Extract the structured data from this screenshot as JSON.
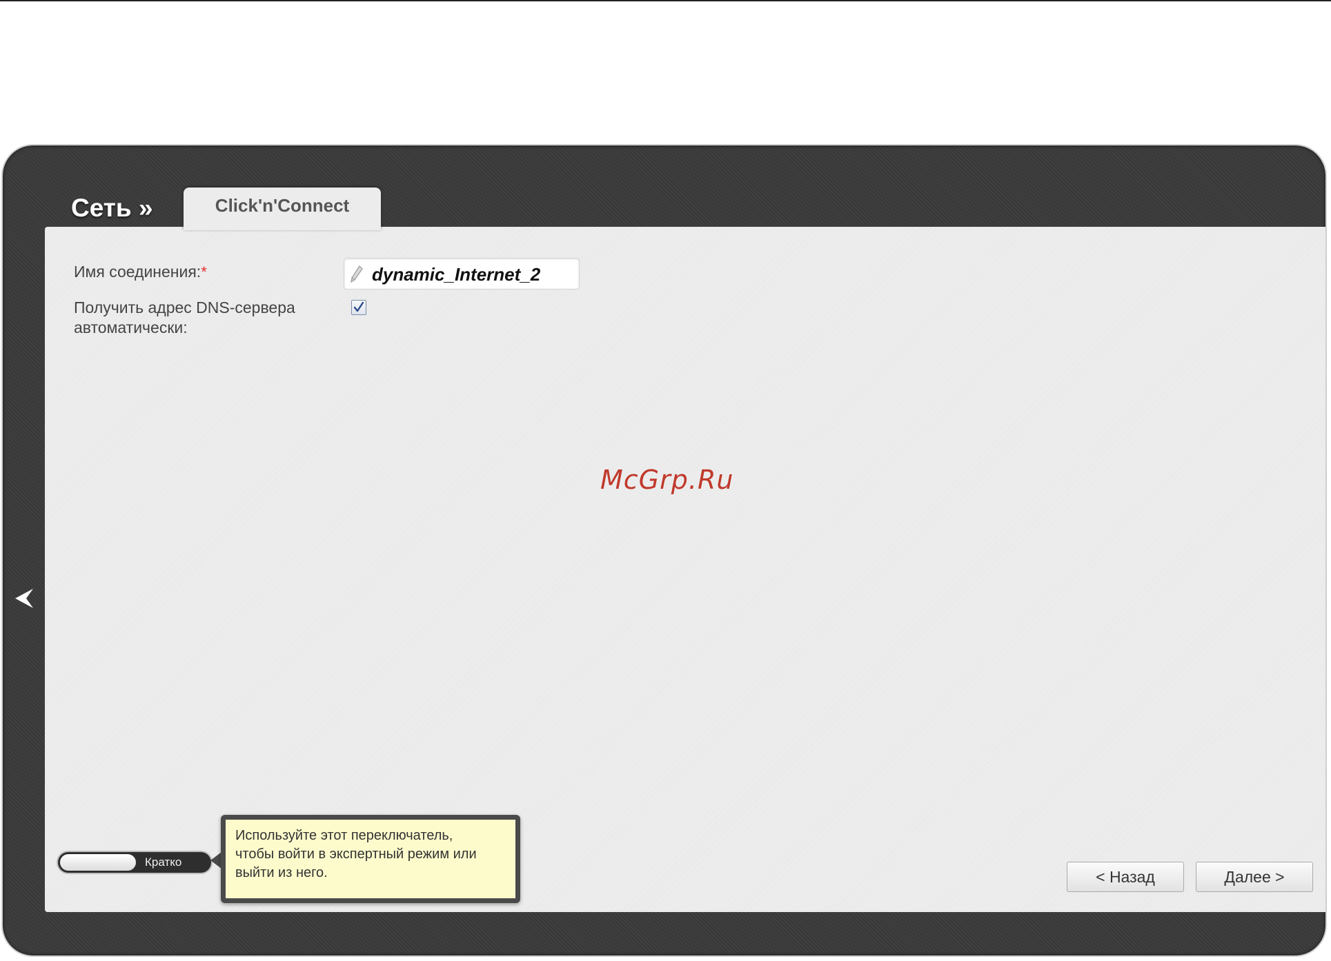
{
  "header": {
    "section_title": "Сеть »",
    "tab_label": "Click'n'Connect"
  },
  "form": {
    "connection_name_label": "Имя соединения:",
    "required_mark": "*",
    "connection_name_value": "dynamic_Internet_2",
    "dns_auto_label_line1": "Получить адрес DNS-сервера",
    "dns_auto_label_line2": "автоматически:",
    "dns_auto_checked": true
  },
  "watermark": "McGrp.Ru",
  "footer": {
    "mode_switch_label": "Кратко",
    "tooltip_line1": "Используйте этот переключатель,",
    "tooltip_line2": "чтобы войти в экспертный режим или",
    "tooltip_line3": "выйти из него.",
    "back_button": "< Назад",
    "next_button": "Далее >"
  },
  "icons": {
    "input_icon": "pencil-icon",
    "sidebar_toggle": "chevron-left-icon",
    "checkbox_mark": "checkmark-icon"
  },
  "colors": {
    "frame": "#3a3a3a",
    "panel": "#ececec",
    "required": "#e53030",
    "tooltip_bg": "#fdfbcc",
    "watermark": "#c0392b"
  }
}
